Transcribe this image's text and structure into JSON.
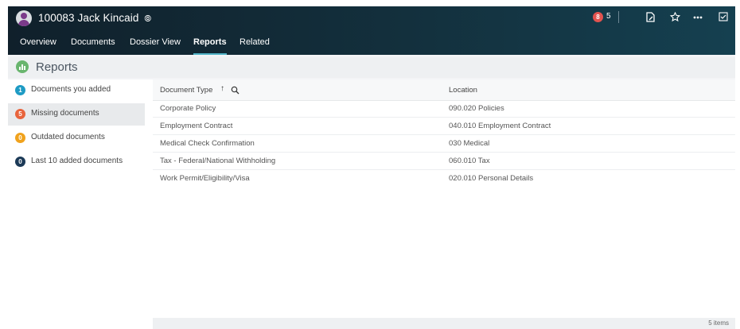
{
  "header": {
    "record_title": "100083 Jack Kincaid",
    "external_glyph": "⦾",
    "alert_count": "5",
    "alert_badge_glyph": "8",
    "tabs": [
      {
        "label": "Overview",
        "active": false
      },
      {
        "label": "Documents",
        "active": false
      },
      {
        "label": "Dossier View",
        "active": false
      },
      {
        "label": "Reports",
        "active": true
      },
      {
        "label": "Related",
        "active": false
      }
    ],
    "icons": [
      "document-sign-icon",
      "star-icon",
      "more-icon",
      "checkbox-icon"
    ]
  },
  "section": {
    "title": "Reports"
  },
  "sidebar": {
    "items": [
      {
        "count": "1",
        "label": "Documents you added",
        "color": "#1e9bc4",
        "selected": false
      },
      {
        "count": "5",
        "label": "Missing documents",
        "color": "#e8643c",
        "selected": true
      },
      {
        "count": "0",
        "label": "Outdated documents",
        "color": "#f0a21d",
        "selected": false
      },
      {
        "count": "0",
        "label": "Last 10 added documents",
        "color": "#1c3a57",
        "selected": false
      }
    ]
  },
  "table": {
    "columns": [
      "Document Type",
      "Location"
    ],
    "sort_glyph": "↑",
    "rows": [
      [
        "Corporate Policy",
        "090.020 Policies"
      ],
      [
        "Employment Contract",
        "040.010 Employment Contract"
      ],
      [
        "Medical Check Confirmation",
        "030 Medical"
      ],
      [
        "Tax - Federal/National Withholding",
        "060.010 Tax"
      ],
      [
        "Work Permit/Eligibility/Visa",
        "020.010 Personal Details"
      ]
    ],
    "footer": "5 items"
  },
  "colors": {
    "header_bg": "#13303d",
    "active_tab_underline": "#4fb3c6",
    "alert": "#e2534f",
    "reports_icon": "#69b56e"
  }
}
